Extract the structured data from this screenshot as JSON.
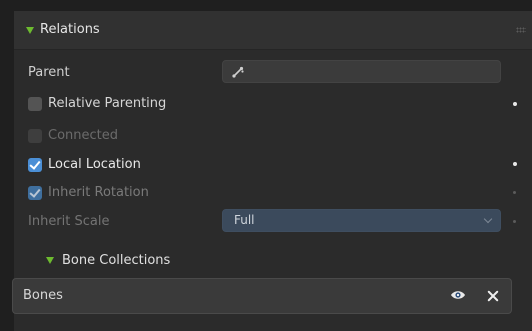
{
  "relations_panel": {
    "title": "Relations",
    "parent": {
      "label": "Parent",
      "value": ""
    },
    "relative_parenting": {
      "label": "Relative Parenting",
      "checked": false
    },
    "connected": {
      "label": "Connected",
      "checked": false,
      "enabled": false
    },
    "local_location": {
      "label": "Local Location",
      "checked": true
    },
    "inherit_rotation": {
      "label": "Inherit Rotation",
      "checked": true,
      "enabled": false
    },
    "inherit_scale": {
      "label": "Inherit Scale",
      "value": "Full",
      "enabled": false
    }
  },
  "bone_collections": {
    "title": "Bone Collections",
    "items": [
      {
        "name": "Bones"
      }
    ]
  },
  "colors": {
    "accent_blue": "#4b8fd6",
    "expand_triangle_green": "#6dbb2f",
    "panel_background": "#2b2b2b"
  }
}
